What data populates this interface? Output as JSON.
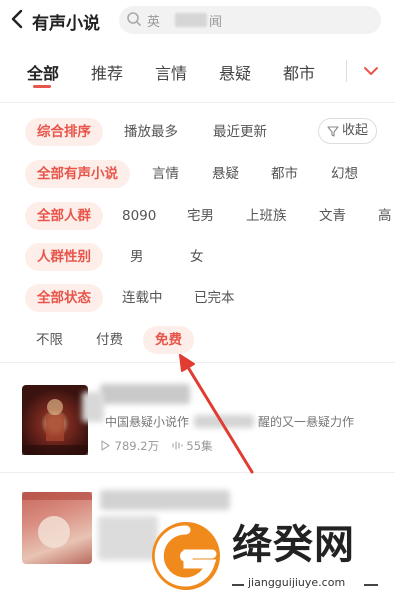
{
  "header": {
    "back_icon": "chevron-left-icon",
    "title": "有声小说",
    "search_placeholder_start": "英",
    "search_placeholder_end": "闻"
  },
  "tabs": [
    {
      "label": "全部",
      "active": true
    },
    {
      "label": "推荐"
    },
    {
      "label": "言情"
    },
    {
      "label": "悬疑"
    },
    {
      "label": "都市"
    }
  ],
  "filters": {
    "sort": {
      "selected": "综合排序",
      "options": [
        "播放最多",
        "最近更新"
      ],
      "collapse_label": "收起"
    },
    "category": {
      "selected": "全部有声小说",
      "options": [
        "言情",
        "悬疑",
        "都市",
        "幻想"
      ]
    },
    "audience": {
      "selected": "全部人群",
      "options": [
        "8090",
        "宅男",
        "上班族",
        "文青",
        "高"
      ]
    },
    "gender": {
      "selected": "人群性别",
      "options": [
        "男",
        "女"
      ]
    },
    "status": {
      "selected": "全部状态",
      "options": [
        "连载中",
        "已完本"
      ]
    },
    "price": {
      "options": [
        "不限",
        "付费"
      ],
      "selected": "免费"
    }
  },
  "list": [
    {
      "desc_start": "中国悬疑小说作",
      "desc_end": "醒的又一悬疑力作",
      "plays": "789.2万",
      "episodes": "55集"
    }
  ],
  "watermark": {
    "name": "绛癸网",
    "url": "jiangguijiuye.com"
  },
  "colors": {
    "accent": "#e8554a",
    "accent_bg": "#fdeee9",
    "arrow": "#e03c31"
  }
}
